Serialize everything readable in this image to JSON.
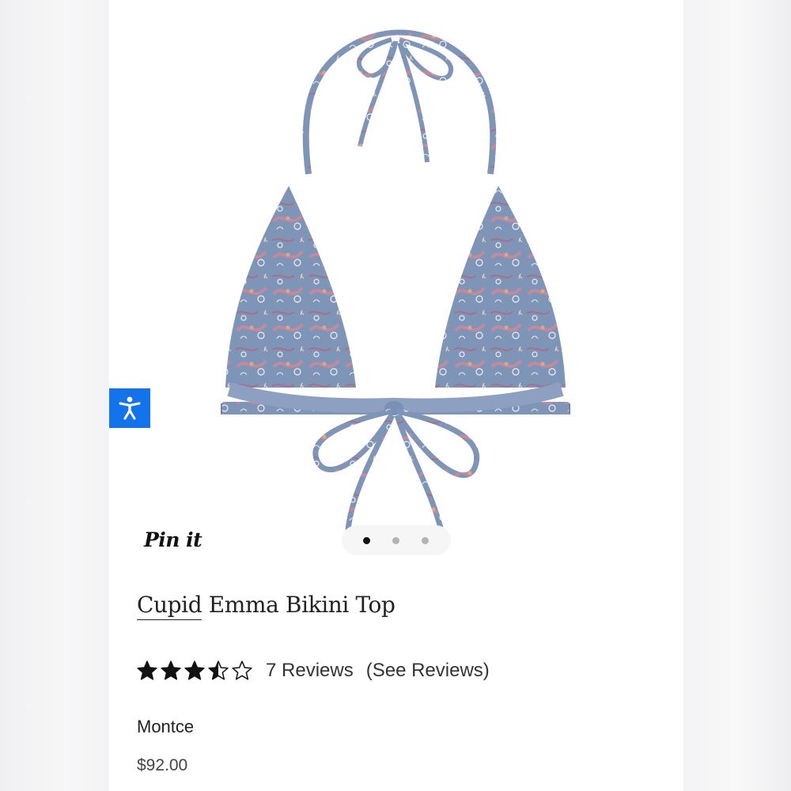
{
  "product": {
    "brand": "Cupid",
    "title_rest": " Emma Bikini Top",
    "image_icon": "bikini-top-product-photo"
  },
  "pin": {
    "label": "Pin it"
  },
  "carousel": {
    "total_slides": 3,
    "active_slide": 1
  },
  "rating": {
    "value": 3.5,
    "max": 5,
    "reviews_label": "7 Reviews",
    "see_reviews_label": "(See Reviews)"
  },
  "store": {
    "name": "Montce"
  },
  "price": {
    "amount": "$92.00"
  },
  "accessibility": {
    "icon": "accessibility-person-icon",
    "color": "#1273eb"
  }
}
